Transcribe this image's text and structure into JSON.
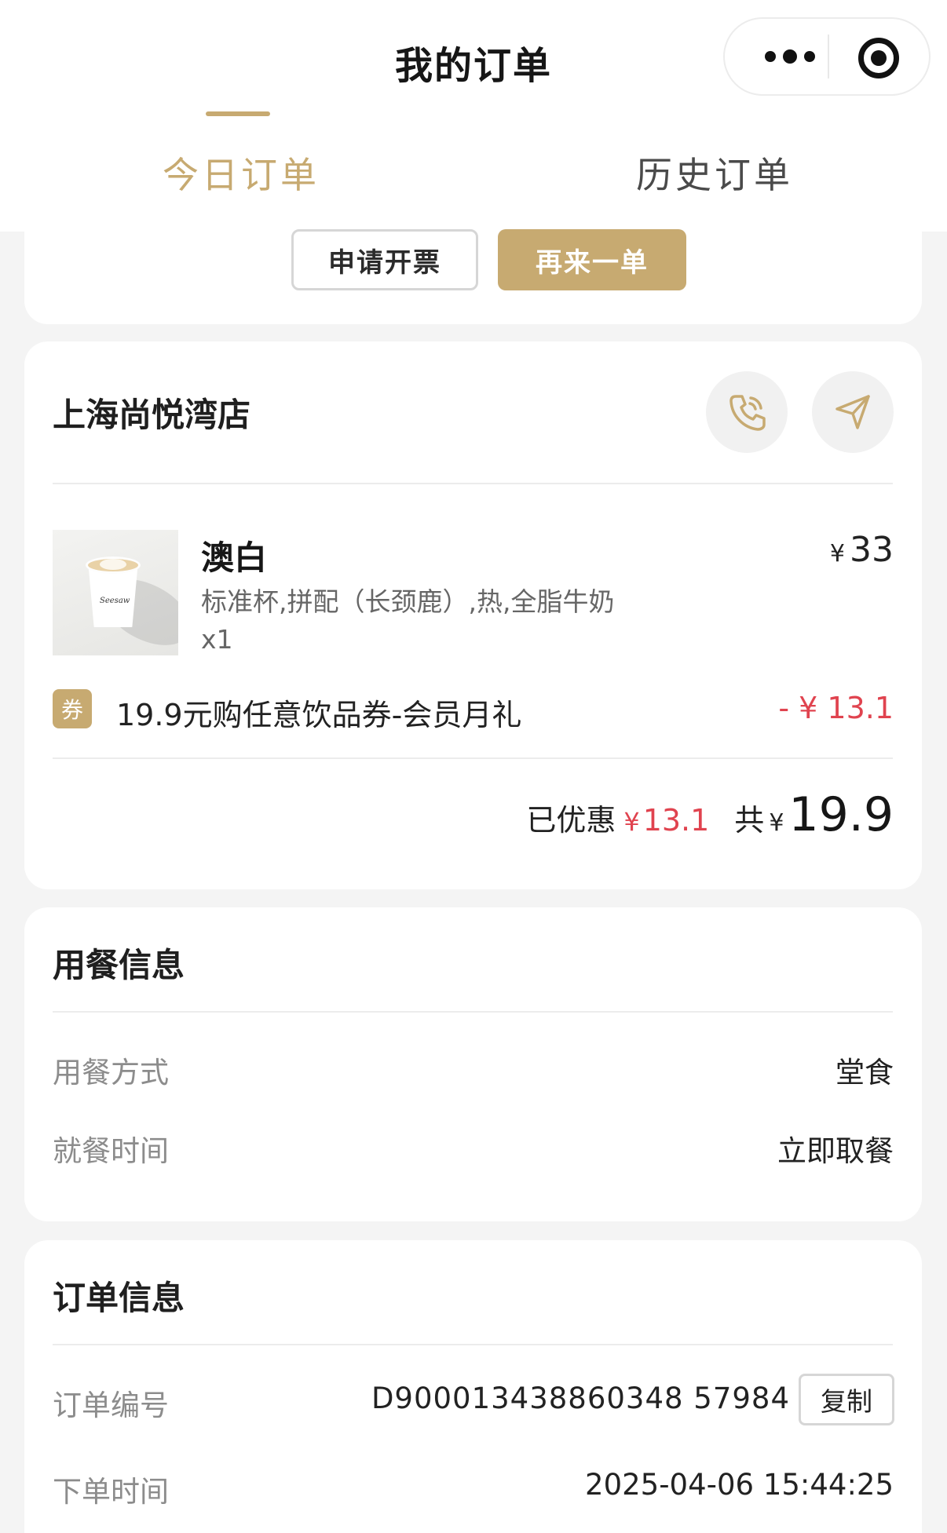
{
  "header": {
    "title": "我的订单"
  },
  "tabs": [
    {
      "label": "今日订单",
      "active": true
    },
    {
      "label": "历史订单",
      "active": false
    }
  ],
  "actions": {
    "invoice_label": "申请开票",
    "reorder_label": "再来一单"
  },
  "store": {
    "name": "上海尚悦湾店"
  },
  "item": {
    "name": "澳白",
    "spec": "标准杯,拼配（长颈鹿）,热,全脂牛奶",
    "qty": "x1",
    "currency": "¥",
    "price": "33"
  },
  "coupon": {
    "badge": "券",
    "name": "19.9元购任意饮品券-会员月礼",
    "amount": "- ¥ 13.1"
  },
  "summary": {
    "discount_label": "已优惠",
    "currency": "¥",
    "discount": "13.1",
    "total_label": "共",
    "total": "19.9"
  },
  "dining": {
    "title": "用餐信息",
    "rows": [
      {
        "label": "用餐方式",
        "value": "堂食"
      },
      {
        "label": "就餐时间",
        "value": "立即取餐"
      }
    ]
  },
  "order_info": {
    "title": "订单信息",
    "number_label": "订单编号",
    "number": "D900013438860348 57984",
    "copy_label": "复制",
    "time_label": "下单时间",
    "time": "2025-04-06 15:44:25"
  },
  "colors": {
    "accent": "#c7aa71",
    "discount": "#e0434f",
    "background": "#f4f4f4"
  }
}
